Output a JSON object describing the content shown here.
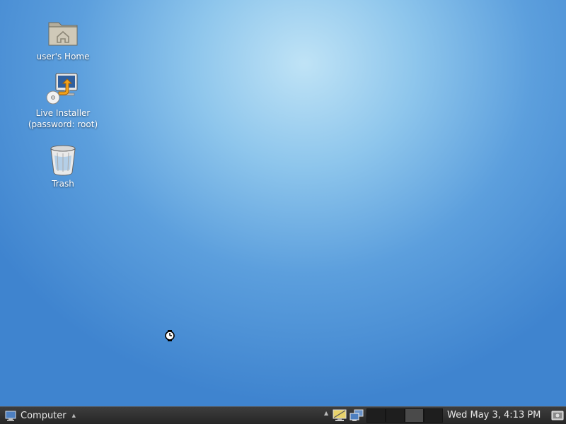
{
  "desktop": {
    "icons": [
      {
        "label": "user's Home",
        "icon": "home-folder-icon"
      },
      {
        "label": "Live Installer\n(password: root)",
        "icon": "installer-icon"
      },
      {
        "label": "Trash",
        "icon": "trash-icon"
      }
    ]
  },
  "taskbar": {
    "start_label": "Computer",
    "clock": "Wed May  3,  4:13 PM",
    "workspaces": 4,
    "active_workspace": 3
  },
  "colors": {
    "desktop_top": "#bfe3f6",
    "desktop_bottom": "#3f84cf",
    "taskbar": "#2d2d2d"
  }
}
